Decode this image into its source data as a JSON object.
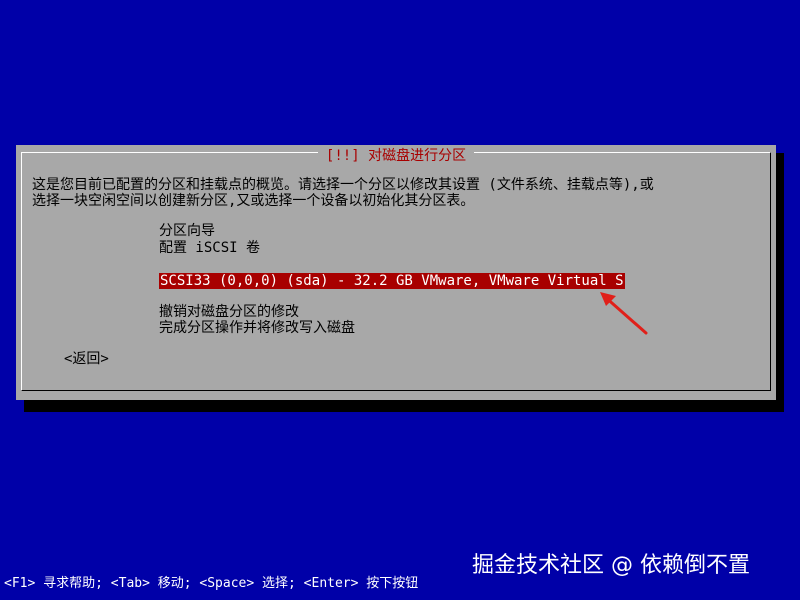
{
  "dialog": {
    "title": "[!!] 对磁盘进行分区",
    "description": "这是您目前已配置的分区和挂载点的概览。请选择一个分区以修改其设置 (文件系统、挂载点等),或\n选择一块空闲空间以创建新分区,又或选择一个设备以初始化其分区表。",
    "menu_items": [
      "分区向导",
      "配置 iSCSI 卷",
      "SCSI33 (0,0,0) (sda) - 32.2 GB VMware, VMware Virtual S",
      "撤销对磁盘分区的修改",
      "完成分区操作并将修改写入磁盘"
    ],
    "back_label": "<返回>"
  },
  "annotation": {
    "arrow_color": "#e0201a",
    "icon": "red-arrow-icon"
  },
  "colors": {
    "background": "#0000a8",
    "dialog": "#a8a8a8",
    "selection": "#a80000",
    "title_text": "#a80000"
  },
  "watermark": {
    "text": "掘金技术社区 @ 依赖倒不置"
  },
  "footer": {
    "help_text": "<F1> 寻求帮助; <Tab> 移动; <Space> 选择; <Enter> 按下按钮"
  }
}
